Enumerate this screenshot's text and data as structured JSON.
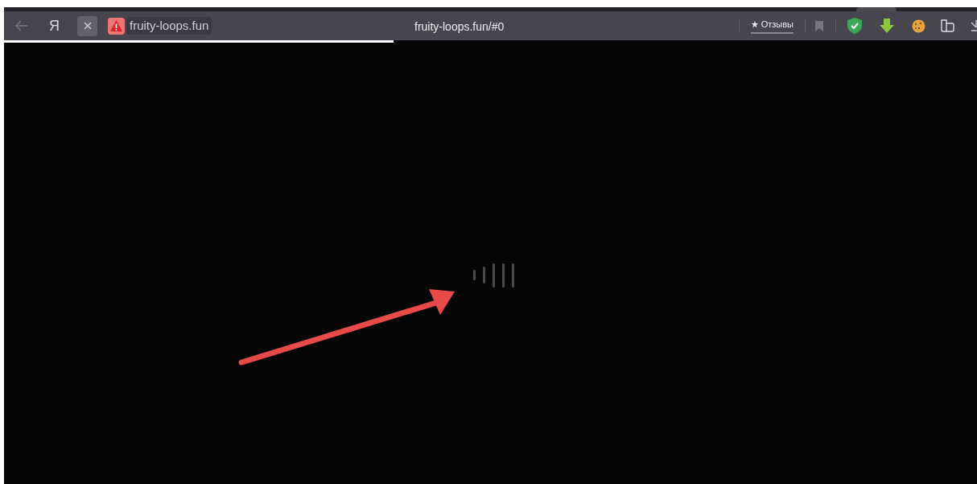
{
  "toolbar": {
    "site_name": "fruity-loops.fun",
    "address": "fruity-loops.fun/#0",
    "reviews_button": "★ Отзывы",
    "yandex_button": "Я"
  },
  "page_load": {
    "level": 0.4
  }
}
